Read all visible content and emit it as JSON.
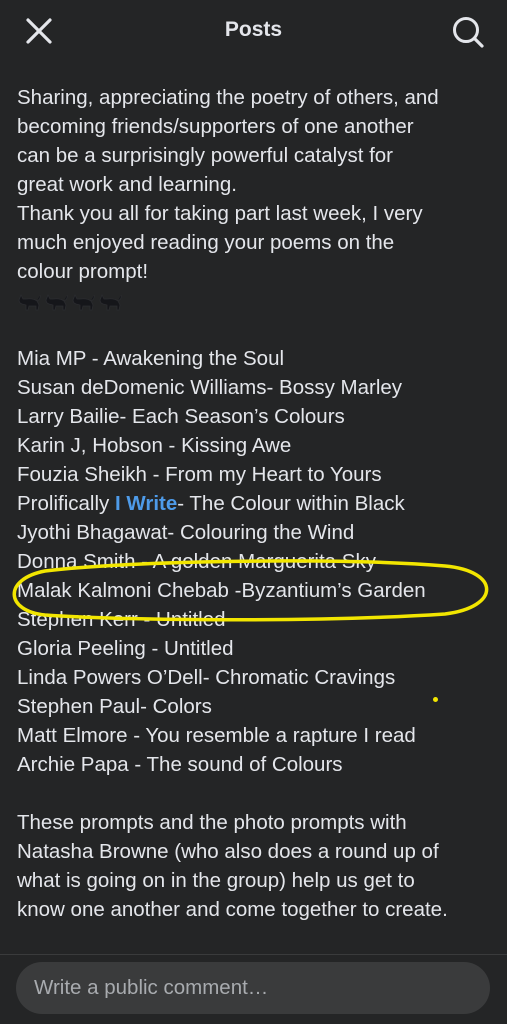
{
  "header": {
    "title": "Posts",
    "close_icon": "close-icon",
    "search_icon": "search-icon"
  },
  "post": {
    "intro_lines": [
      "Sharing, appreciating the poetry of others, and",
      "becoming friends/supporters of one another",
      "can be a surprisingly powerful catalyst for",
      "great work and learning.",
      "Thank you all for taking part last week, I very",
      "much enjoyed reading your poems on the",
      "colour prompt!"
    ],
    "emoji": "black-cat-emoji",
    "entries": [
      "Mia MP - Awakening the Soul",
      "Susan deDomenic Williams- Bossy Marley",
      "Larry Bailie- Each Season’s Colours",
      "Karin J, Hobson - Kissing Awe",
      "Fouzia Sheikh - From my Heart to Yours"
    ],
    "mention_entry": {
      "prefix": "Prolifically ",
      "mention": "I Write",
      "suffix": "- The Colour within Black"
    },
    "entries_2": [
      "Jyothi Bhagawat- Colouring the Wind",
      "Donna Smith - A golden Marguerita Sky",
      "Malak Kalmoni Chebab -Byzantium’s Garden",
      "Stephen Kerr - Untitled",
      "Gloria Peeling - Untitled",
      "Linda Powers O’Dell- Chromatic Cravings",
      "Stephen Paul- Colors",
      "Matt Elmore - You resemble a rapture I read",
      "Archie Papa - The sound of Colours"
    ],
    "outro_lines": [
      "These prompts and the photo prompts with",
      "Natasha Browne (who also does a round up of",
      "what is going on in the group) help us get to",
      "know one another and come together to create."
    ]
  },
  "annotation": {
    "color": "#f2e600"
  },
  "comment": {
    "placeholder": "Write a public comment…"
  }
}
